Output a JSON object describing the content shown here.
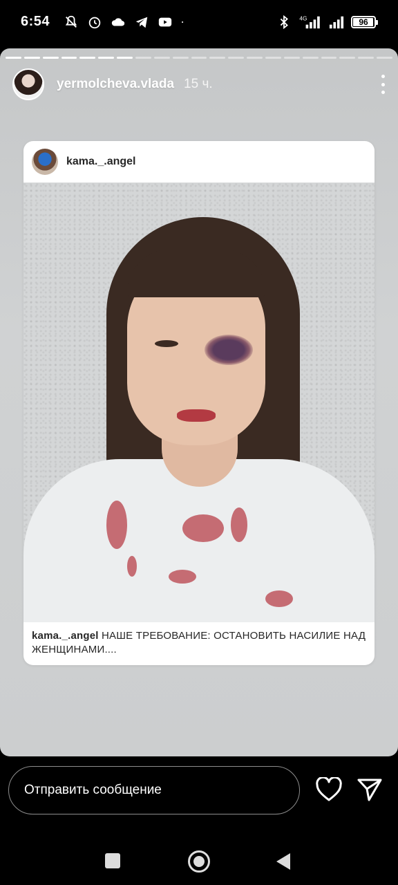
{
  "status_bar": {
    "time": "6:54",
    "network_type": "4G",
    "battery": "96",
    "battery_level": 0.96,
    "icons": [
      "notifications-off-icon",
      "alarm-icon",
      "cloud-icon",
      "telegram-icon",
      "youtube-icon",
      "dot-icon",
      "bluetooth-icon",
      "signal-4g-icon",
      "signal-icon",
      "battery-icon"
    ]
  },
  "story": {
    "username": "yermolcheva.vlada",
    "time_ago": "15 ч.",
    "progress_segments": 21,
    "progress_done": 7,
    "more_icon": "more-vertical-icon"
  },
  "shared_post": {
    "username": "kama._.angel",
    "caption_user": "kama._.angel",
    "caption_text": " НАШЕ ТРЕБОВАНИЕ: ОСТАНОВИТЬ НАСИЛИЕ НАД ЖЕНЩИНАМИ...."
  },
  "reply_bar": {
    "placeholder": "Отправить сообщение",
    "like_icon": "heart-icon",
    "send_icon": "send-icon"
  },
  "nav_bar": {
    "icons": [
      "recents-square-icon",
      "home-circle-icon",
      "back-triangle-icon"
    ]
  },
  "colors": {
    "story_bg": "#c9cbcc",
    "card_bg": "#ffffff",
    "text_dark": "#262626",
    "system_bg": "#000000"
  }
}
